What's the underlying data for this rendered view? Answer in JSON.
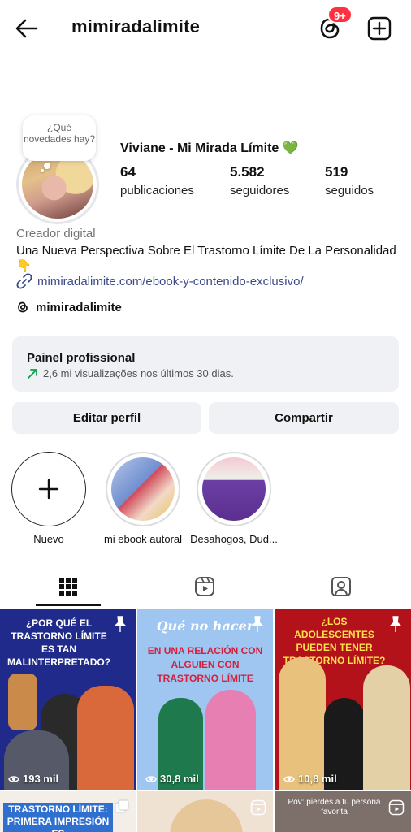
{
  "header": {
    "username": "mimiradalimite",
    "badge": "9+"
  },
  "profile": {
    "note": "¿Qué novedades hay?",
    "display_name": "Viviane - Mi Mirada Límite 💚",
    "stats": [
      {
        "num": "64",
        "label": "publicaciones"
      },
      {
        "num": "5.582",
        "label": "seguidores"
      },
      {
        "num": "519",
        "label": "seguidos"
      }
    ],
    "category": "Creador digital",
    "bio": "Una Nueva Perspectiva Sobre El Trastorno Límite De La Personalidad 👇",
    "link": "mimiradalimite.com/ebook-y-contenido-exclusivo/",
    "threads": "mimiradalimite"
  },
  "pro_panel": {
    "title": "Painel profissional",
    "subtitle": "2,6 mi visualizações nos últimos 30 dias."
  },
  "buttons": {
    "edit": "Editar perfil",
    "share": "Compartir"
  },
  "highlights": [
    {
      "label": "Nuevo"
    },
    {
      "label": "mi ebook autoral"
    },
    {
      "label": "Desahogos, Dud..."
    }
  ],
  "posts": [
    {
      "title": "¿POR QUÉ EL TRASTORNO LÍMITE ES TAN MALINTERPRETADO?",
      "views": "193 mil",
      "bg": "#1f2a8a"
    },
    {
      "title_line1": "Qué no hacer",
      "title_line2": "EN UNA RELACIÓN CON ALGUIEN CON TRASTORNO LÍMITE",
      "views": "30,8 mil",
      "bg": "#9ec6f0"
    },
    {
      "title": "¿LOS ADOLESCENTES PUEDEN TENER TRASTORNO LÍMITE?",
      "views": "10,8 mil",
      "bg": "#b3121b"
    },
    {
      "title": "TRASTORNO LÍMITE: PRIMERA IMPRESIÓN ES",
      "bg": "#2f6fcf"
    },
    {
      "bg": "#f0e4d6"
    },
    {
      "title": "Pov: pierdes a tu persona favorita",
      "bg": "#7d6f6a"
    }
  ]
}
